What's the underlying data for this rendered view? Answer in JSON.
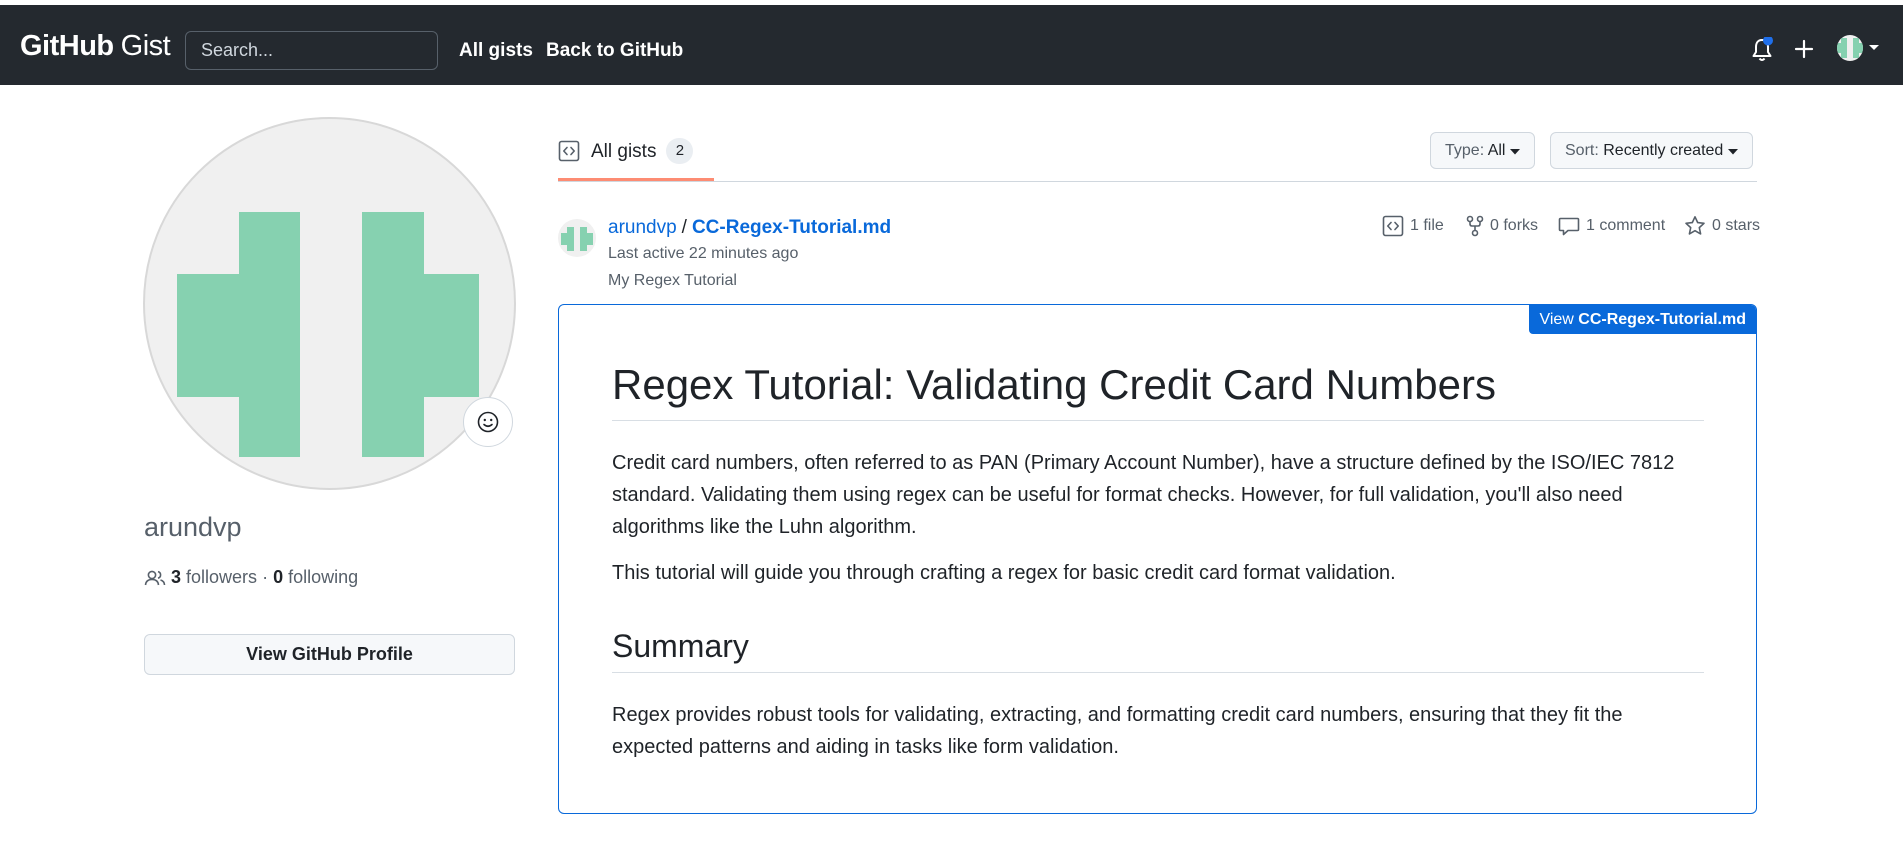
{
  "header": {
    "logo_bold": "GitHub",
    "logo_light": "Gist",
    "search_placeholder": "Search...",
    "nav": [
      "All gists",
      "Back to GitHub"
    ]
  },
  "profile": {
    "username": "arundvp",
    "followers_count": "3",
    "followers_label": "followers",
    "separator": "·",
    "following_count": "0",
    "following_label": "following",
    "button_label": "View GitHub Profile",
    "avatar_color": "#86d1b0"
  },
  "tabs": {
    "label": "All gists",
    "count": "2"
  },
  "filters": {
    "type_key": "Type:",
    "type_value": "All",
    "sort_key": "Sort:",
    "sort_value": "Recently created"
  },
  "gist": {
    "owner": "arundvp",
    "slash": "/",
    "filename": "CC-Regex-Tutorial.md",
    "last_active": "Last active 22 minutes ago",
    "description": "My Regex Tutorial",
    "stats": {
      "files": "1 file",
      "forks": "0 forks",
      "comments": "1 comment",
      "stars": "0 stars"
    },
    "view_prefix": "View",
    "view_file": "CC-Regex-Tutorial.md",
    "content": {
      "h1": "Regex Tutorial: Validating Credit Card Numbers",
      "p1": "Credit card numbers, often referred to as PAN (Primary Account Number), have a structure defined by the ISO/IEC 7812 standard. Validating them using regex can be useful for format checks. However, for full validation, you'll also need algorithms like the Luhn algorithm.",
      "p2": "This tutorial will guide you through crafting a regex for basic credit card format validation.",
      "h2": "Summary",
      "p3": "Regex provides robust tools for validating, extracting, and formatting credit card numbers, ensuring that they fit the expected patterns and aiding in tasks like form validation."
    }
  },
  "colors": {
    "header_bg": "#24292f",
    "link": "#0969da",
    "tab_underline": "#fd8c73",
    "notification_dot": "#1f6feb"
  }
}
